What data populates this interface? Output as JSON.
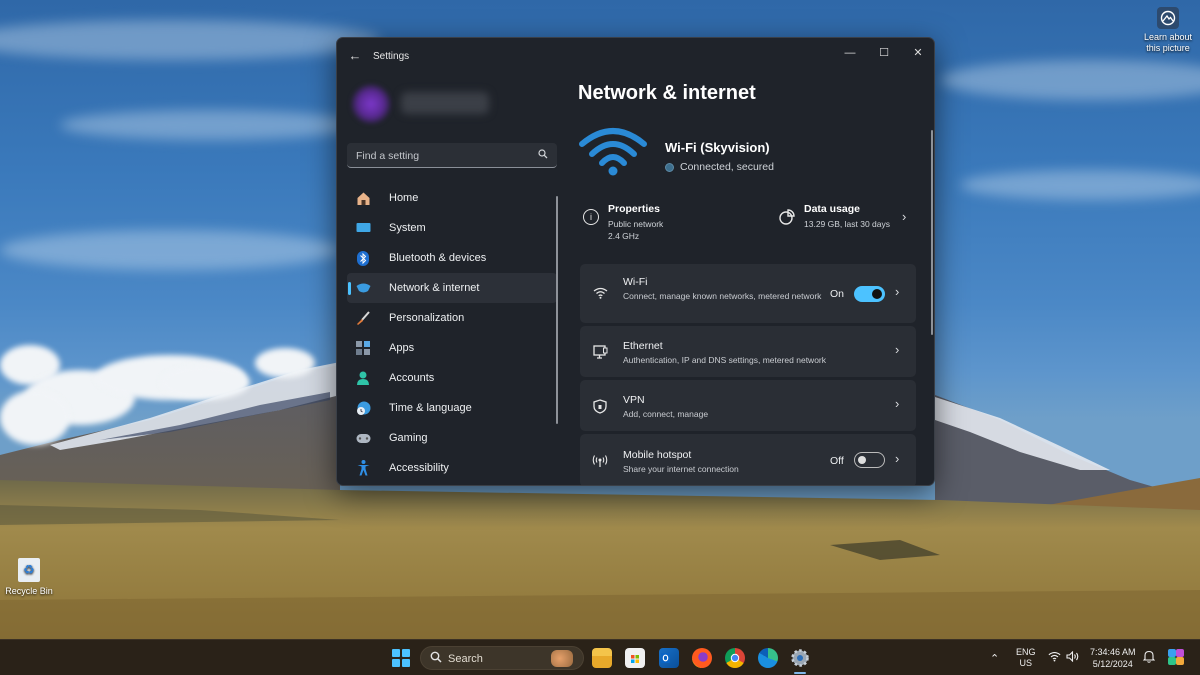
{
  "desktop": {
    "learn_about_picture": "Learn about\nthis picture",
    "recycle_bin": "Recycle Bin"
  },
  "window": {
    "title": "Settings",
    "controls": {
      "minimize": "—",
      "maximize": "☐",
      "close": "✕"
    }
  },
  "sidebar": {
    "search_placeholder": "Find a setting",
    "items": [
      {
        "label": "Home",
        "icon": "home-icon",
        "active": false
      },
      {
        "label": "System",
        "icon": "system-icon",
        "active": false
      },
      {
        "label": "Bluetooth & devices",
        "icon": "bluetooth-icon",
        "active": false
      },
      {
        "label": "Network & internet",
        "icon": "network-icon",
        "active": true
      },
      {
        "label": "Personalization",
        "icon": "brush-icon",
        "active": false
      },
      {
        "label": "Apps",
        "icon": "apps-icon",
        "active": false
      },
      {
        "label": "Accounts",
        "icon": "accounts-icon",
        "active": false
      },
      {
        "label": "Time & language",
        "icon": "clock-globe-icon",
        "active": false
      },
      {
        "label": "Gaming",
        "icon": "gamepad-icon",
        "active": false
      },
      {
        "label": "Accessibility",
        "icon": "accessibility-icon",
        "active": false
      }
    ]
  },
  "main": {
    "title": "Network & internet",
    "connection": {
      "name": "Wi-Fi (Skyvision)",
      "status": "Connected, secured"
    },
    "properties": {
      "title": "Properties",
      "line1": "Public network",
      "line2": "2.4 GHz"
    },
    "data_usage": {
      "title": "Data usage",
      "detail": "13.29 GB, last 30 days"
    },
    "cards": [
      {
        "title": "Wi-Fi",
        "subtitle": "Connect, manage known networks, metered network",
        "state": "On",
        "toggle": true
      },
      {
        "title": "Ethernet",
        "subtitle": "Authentication, IP and DNS settings, metered network"
      },
      {
        "title": "VPN",
        "subtitle": "Add, connect, manage"
      },
      {
        "title": "Mobile hotspot",
        "subtitle": "Share your internet connection",
        "state": "Off",
        "toggle": false
      }
    ]
  },
  "taskbar": {
    "search_label": "Search",
    "apps": [
      "File Explorer",
      "Microsoft Store",
      "Outlook",
      "Firefox",
      "Chrome",
      "Edge",
      "Settings"
    ],
    "language_top": "ENG",
    "language_bottom": "US",
    "time": "7:34:46 AM",
    "date": "5/12/2024"
  },
  "colors": {
    "accent": "#4cc2ff",
    "window_bg": "#1f232a",
    "card_bg": "#2a2e35",
    "wifi_hero": "#2a8ad6"
  }
}
